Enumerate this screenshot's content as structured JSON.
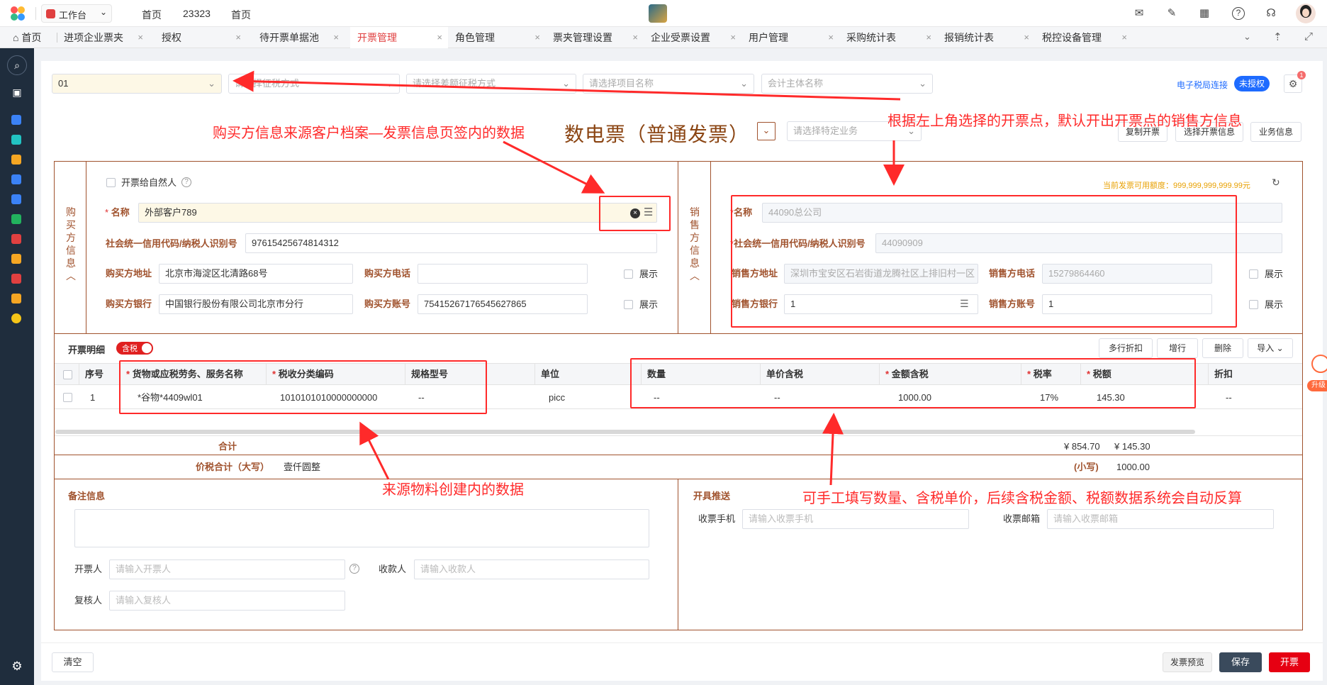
{
  "header": {
    "workspace": "工作台",
    "nav": [
      "首页",
      "23323",
      "首页"
    ]
  },
  "tabs": [
    {
      "label": "首页"
    },
    {
      "label": "进项企业票夹"
    },
    {
      "label": "授权"
    },
    {
      "label": "待开票单据池"
    },
    {
      "label": "开票管理"
    },
    {
      "label": "角色管理"
    },
    {
      "label": "票夹管理设置"
    },
    {
      "label": "企业受票设置"
    },
    {
      "label": "用户管理"
    },
    {
      "label": "采购统计表"
    },
    {
      "label": "报销统计表"
    },
    {
      "label": "税控设备管理"
    }
  ],
  "colors": {
    "accent": "#e04040",
    "annotation": "#ff2a2a",
    "frame": "#a0522d",
    "sidebar": "#1f2d3d",
    "auth_badge": "#1e6bff"
  },
  "filters": {
    "point_value": "01",
    "tax_method_placeholder": "请选择征税方式",
    "diff_tax_placeholder": "请选择差额征税方式",
    "project_placeholder": "请选择项目名称",
    "entity_placeholder": "会计主体名称",
    "connection_label": "电子税局连接",
    "auth_status": "未授权",
    "settings_badge": "1"
  },
  "invoice": {
    "title": "数电票（普通发票）",
    "special_business_placeholder": "请选择特定业务",
    "copy_btn": "复制开票",
    "choose_btn": "选择开票信息",
    "business_btn": "业务信息",
    "quota_label": "当前发票可用额度：999,999,999,999.99元"
  },
  "buyer": {
    "section_title": "购买方信息",
    "natural_person_label": "开票给自然人",
    "name_label": "名称",
    "name_value": "外部客户789",
    "tax_id_label": "社会统一信用代码/纳税人识别号",
    "tax_id_value": "97615425674814312",
    "address_label": "购买方地址",
    "address_value": "北京市海淀区北清路68号",
    "phone_label": "购买方电话",
    "phone_value": "",
    "bank_label": "购买方银行",
    "bank_value": "中国银行股份有限公司北京市分行",
    "account_label": "购买方账号",
    "account_value": "75415267176545627865",
    "show_label": "展示"
  },
  "seller": {
    "section_title": "销售方信息",
    "name_label": "名称",
    "name_value": "44090总公司",
    "tax_id_label": "社会统一信用代码/纳税人识别号",
    "tax_id_value": "44090909",
    "address_label": "销售方地址",
    "address_value": "深圳市宝安区石岩街道龙腾社区上排旧村一区",
    "phone_label": "销售方电话",
    "phone_value": "15279864460",
    "bank_label": "销售方银行",
    "bank_value": "1",
    "account_label": "销售方账号",
    "account_value": "1",
    "show_label": "展示"
  },
  "details": {
    "section_title": "开票明细",
    "tax_toggle": "含税",
    "buttons": [
      "多行折扣",
      "增行",
      "删除",
      "导入"
    ],
    "columns": [
      "序号",
      "货物或应税劳务、服务名称",
      "税收分类编码",
      "规格型号",
      "单位",
      "数量",
      "单价含税",
      "金额含税",
      "税率",
      "税额",
      "折扣"
    ],
    "rows": [
      {
        "no": "1",
        "name": "*谷物*4409wl01",
        "code": "1010101010000000000",
        "spec": "--",
        "unit": "picc",
        "qty": "--",
        "price": "--",
        "amount": "1000.00",
        "rate": "17%",
        "tax": "145.30",
        "discount": "--"
      }
    ],
    "total_label": "合计",
    "total_amount": "¥ 854.70",
    "total_tax": "¥ 145.30",
    "grand_label": "价税合计（大写）",
    "grand_upper": "壹仟圆整",
    "small_label": "(小写)",
    "grand_lower": "1000.00"
  },
  "remarks": {
    "title": "备注信息",
    "issuer_label": "开票人",
    "issuer_placeholder": "请输入开票人",
    "payee_label": "收款人",
    "payee_placeholder": "请输入收款人",
    "reviewer_label": "复核人",
    "reviewer_placeholder": "请输入复核人"
  },
  "push": {
    "title": "开具推送",
    "phone_label": "收票手机",
    "phone_placeholder": "请输入收票手机",
    "email_label": "收票邮箱",
    "email_placeholder": "请输入收票邮箱"
  },
  "footer": {
    "clear": "清空",
    "preview": "发票预览",
    "save": "保存",
    "issue": "开票"
  },
  "upgrade": "升级",
  "annotations": {
    "buyer_source": "购买方信息来源客户档案—发票信息页签内的数据",
    "seller_source": "根据左上角选择的开票点，默认开出开票点的销售方信息",
    "material_source": "来源物料创建内的数据",
    "manual_fill": "可手工填写数量、含税单价，后续含税金额、税额数据系统会自动反算"
  }
}
